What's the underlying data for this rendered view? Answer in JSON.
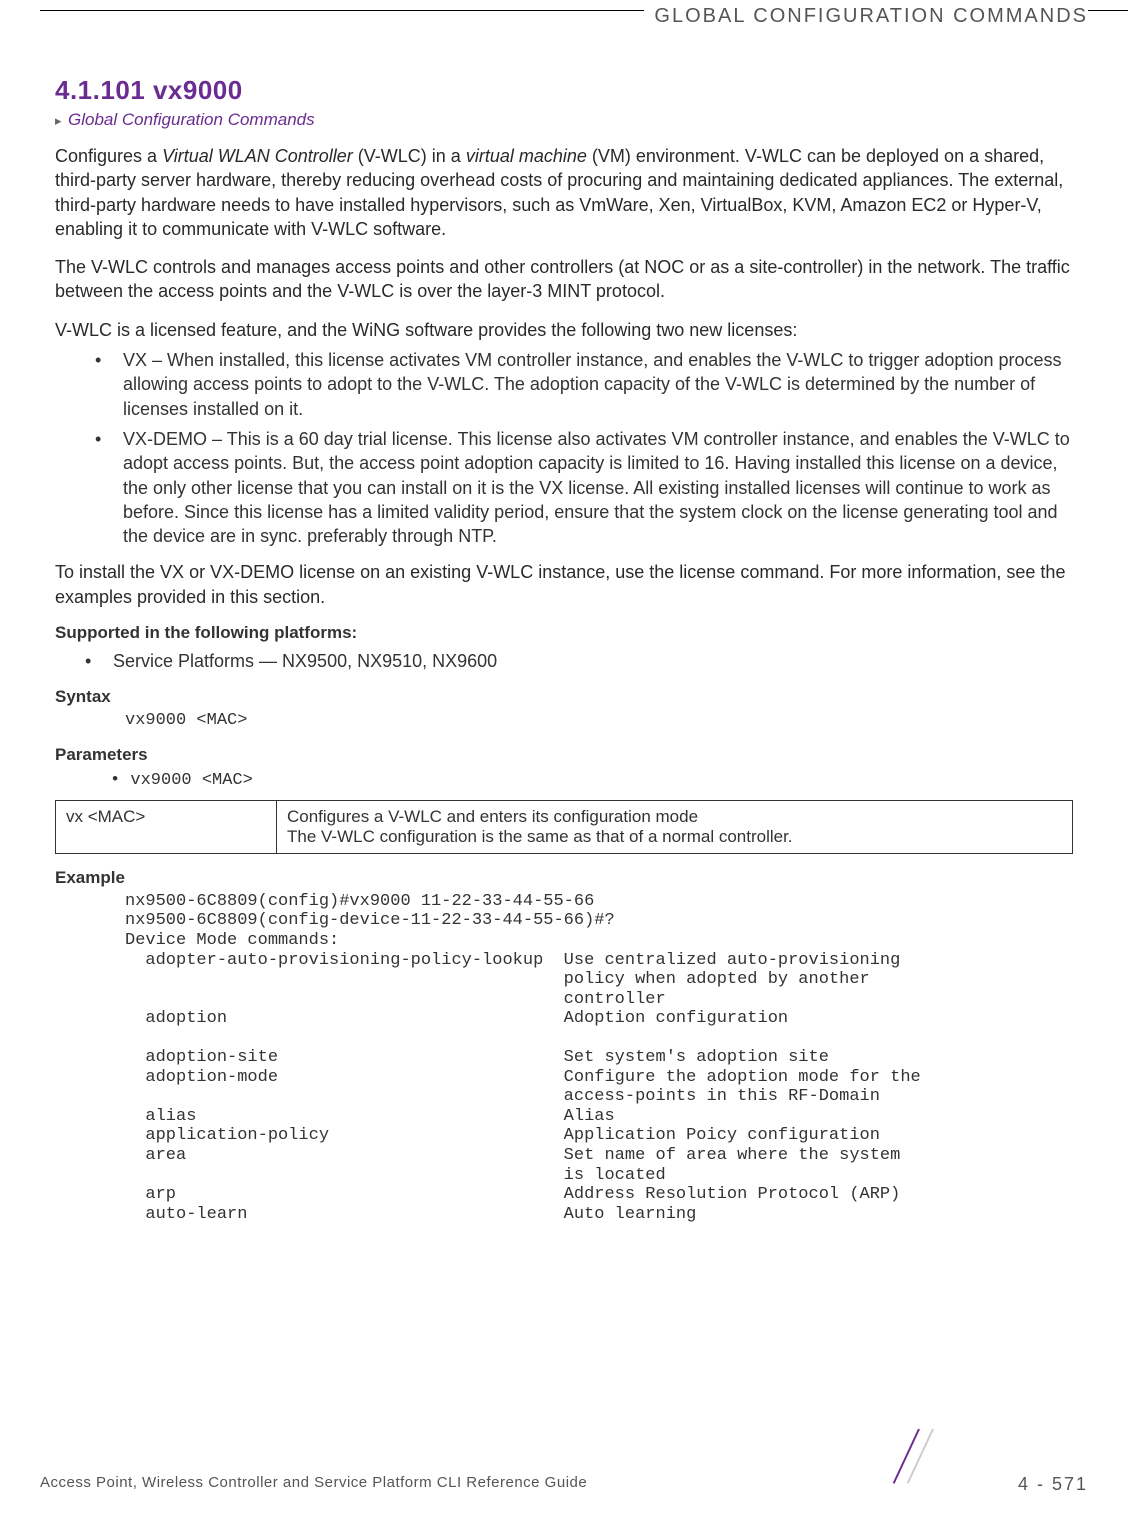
{
  "running_header": "GLOBAL CONFIGURATION COMMANDS",
  "section": {
    "number_title": "4.1.101 vx9000",
    "breadcrumb_arrow": "▸",
    "breadcrumb_link": "Global Configuration Commands"
  },
  "body": {
    "p1_pre": "Configures a ",
    "p1_i1": "Virtual WLAN Controller",
    "p1_mid1": " (V-WLC) in a ",
    "p1_i2": "virtual machine",
    "p1_post": " (VM) environment. V-WLC can be deployed on a shared, third-party server hardware, thereby reducing overhead costs of procuring and maintaining dedicated appliances. The external, third-party hardware needs to have installed hypervisors, such as VmWare, Xen, VirtualBox, KVM, Amazon EC2 or Hyper-V, enabling it to communicate with V-WLC software.",
    "p2": "The V-WLC controls and manages access points and other controllers (at NOC or as a site-controller) in the network. The traffic between the access points and the V-WLC is over the layer-3 MINT protocol.",
    "p3": "V-WLC is a licensed feature, and the WiNG software provides the following two new licenses:",
    "licenses": [
      "VX – When installed, this license activates VM controller instance, and enables the V-WLC to trigger adoption process allowing access points to adopt to the V-WLC. The adoption capacity of the V-WLC is determined by the number of licenses installed on it.",
      "VX-DEMO – This is a 60 day trial license. This license also activates VM controller instance, and enables the V-WLC to adopt access points. But, the access point adoption capacity is limited to 16. Having installed this license on a device, the only other license that you can install on it is the VX license. All existing installed licenses will continue to work as before. Since this license has a limited validity period, ensure that the system clock on the license generating tool and the device are in sync. preferably through NTP."
    ],
    "p4": "To install the VX or VX-DEMO license on an existing V-WLC instance, use the license command. For more information, see the examples provided in this section."
  },
  "supported": {
    "heading": "Supported in the following platforms:",
    "items": [
      "Service Platforms — NX9500, NX9510, NX9600"
    ]
  },
  "syntax": {
    "heading": "Syntax",
    "line": "vx9000 <MAC>"
  },
  "parameters": {
    "heading": "Parameters",
    "bullet": "• vx9000 <MAC>",
    "table": {
      "c1": "vx <MAC>",
      "c2a": "Configures a V-WLC and enters its configuration mode",
      "c2b": "The V-WLC configuration is the same as that of a normal controller."
    }
  },
  "example": {
    "heading": "Example",
    "block": "nx9500-6C8809(config)#vx9000 11-22-33-44-55-66\nnx9500-6C8809(config-device-11-22-33-44-55-66)#?\nDevice Mode commands:\n  adopter-auto-provisioning-policy-lookup  Use centralized auto-provisioning\n                                           policy when adopted by another\n                                           controller\n  adoption                                 Adoption configuration\n\n  adoption-site                            Set system's adoption site\n  adoption-mode                            Configure the adoption mode for the\n                                           access-points in this RF-Domain\n  alias                                    Alias\n  application-policy                       Application Poicy configuration\n  area                                     Set name of area where the system\n                                           is located\n  arp                                      Address Resolution Protocol (ARP)\n  auto-learn                               Auto learning"
  },
  "footer": {
    "left": "Access Point, Wireless Controller and Service Platform CLI Reference Guide",
    "right": "4 - 571"
  }
}
